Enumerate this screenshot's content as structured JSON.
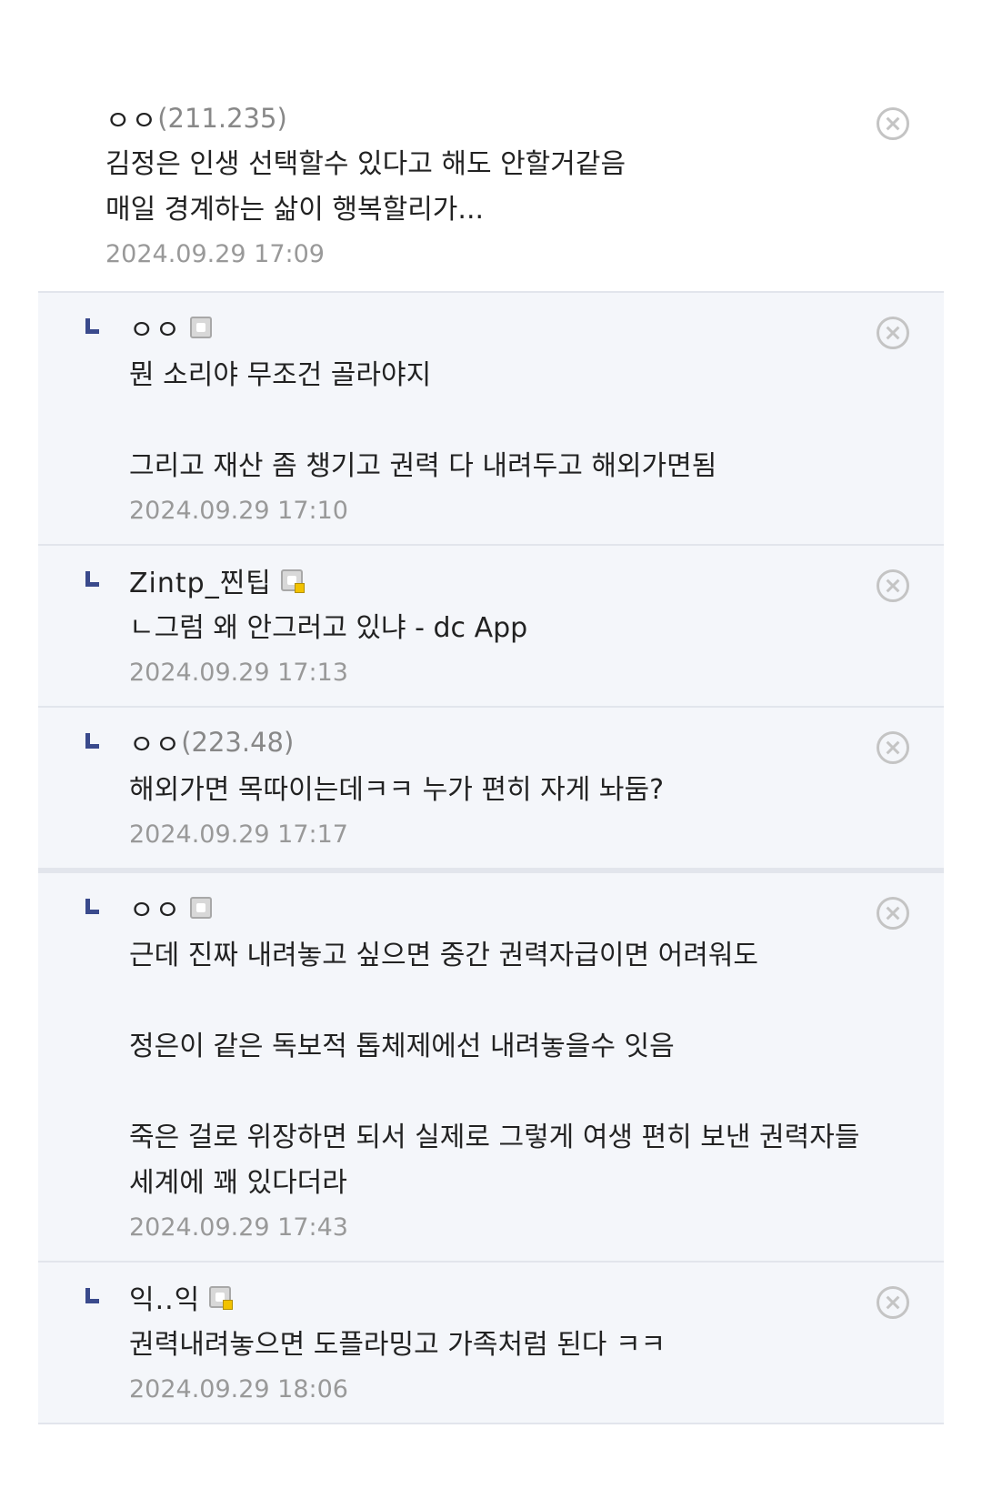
{
  "comments": [
    {
      "author": "ㅇㅇ",
      "ip": "(211.235)",
      "text": "김정은 인생 선택할수 있다고 해도 안할거같음\n매일 경계하는 삶이 행복할리가...",
      "date": "2024.09.29 17:09"
    }
  ],
  "replies": [
    {
      "author": "ㅇㅇ",
      "ip": "",
      "icon": "fixed-nick-icon",
      "text": "뭔 소리야 무조건 골라야지\n\n그리고 재산 좀 챙기고 권력 다 내려두고 해외가면됨",
      "date": "2024.09.29 17:10"
    },
    {
      "author": "Zintp_찐팁",
      "ip": "",
      "icon": "fixed-nick-gold-icon",
      "text": "ㄴ그럼 왜 안그러고 있냐 - dc App",
      "date": "2024.09.29 17:13"
    },
    {
      "author": "ㅇㅇ",
      "ip": "(223.48)",
      "text": "해외가면 목따이는데ㅋㅋ 누가 편히 자게 놔둠?",
      "date": "2024.09.29 17:17"
    },
    {
      "author": "ㅇㅇ",
      "ip": "",
      "icon": "fixed-nick-icon",
      "text": "근데 진짜 내려놓고 싶으면 중간 권력자급이면 어려워도\n\n정은이 같은 독보적 톱체제에선 내려놓을수 잇음\n\n죽은 걸로 위장하면 되서 실제로 그렇게 여생 편히 보낸 권력자들\n세계에 꽤 있다더라",
      "date": "2024.09.29 17:43"
    },
    {
      "author": "익..익",
      "ip": "",
      "icon": "fixed-nick-gold-icon",
      "text": "권력내려놓으면 도플라밍고 가족처럼 된다 ㅋㅋ",
      "date": "2024.09.29 18:06"
    }
  ]
}
